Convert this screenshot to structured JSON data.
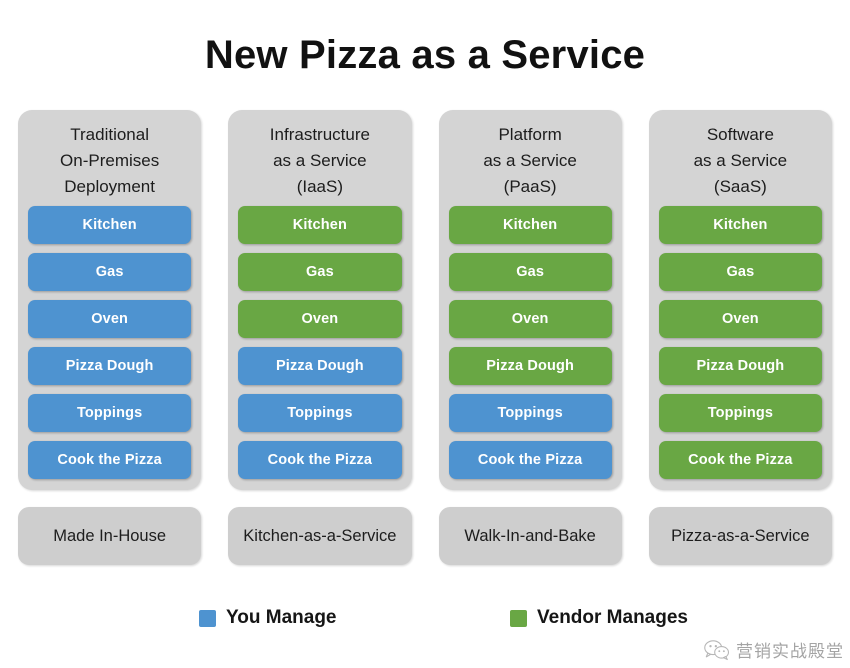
{
  "title": "New Pizza as a Service",
  "colors": {
    "you_manage": "#4e93d0",
    "vendor_manages": "#69a744",
    "panel_background": "#d4d4d4",
    "caption_background": "#cecece",
    "page_background": "#ffffff"
  },
  "columns": [
    {
      "id": "traditional",
      "header_lines": [
        "Traditional",
        "On-Premises",
        "Deployment"
      ],
      "caption": "Made In-House",
      "items": [
        {
          "label": "Kitchen",
          "owner": "you"
        },
        {
          "label": "Gas",
          "owner": "you"
        },
        {
          "label": "Oven",
          "owner": "you"
        },
        {
          "label": "Pizza Dough",
          "owner": "you"
        },
        {
          "label": "Toppings",
          "owner": "you"
        },
        {
          "label": "Cook the Pizza",
          "owner": "you"
        }
      ]
    },
    {
      "id": "iaas",
      "header_lines": [
        "Infrastructure",
        "as a Service",
        "(IaaS)"
      ],
      "caption": "Kitchen-as-a-Service",
      "items": [
        {
          "label": "Kitchen",
          "owner": "vendor"
        },
        {
          "label": "Gas",
          "owner": "vendor"
        },
        {
          "label": "Oven",
          "owner": "vendor"
        },
        {
          "label": "Pizza Dough",
          "owner": "you"
        },
        {
          "label": "Toppings",
          "owner": "you"
        },
        {
          "label": "Cook the Pizza",
          "owner": "you"
        }
      ]
    },
    {
      "id": "paas",
      "header_lines": [
        "Platform",
        "as a Service",
        "(PaaS)"
      ],
      "caption": "Walk-In-and-Bake",
      "items": [
        {
          "label": "Kitchen",
          "owner": "vendor"
        },
        {
          "label": "Gas",
          "owner": "vendor"
        },
        {
          "label": "Oven",
          "owner": "vendor"
        },
        {
          "label": "Pizza Dough",
          "owner": "vendor"
        },
        {
          "label": "Toppings",
          "owner": "you"
        },
        {
          "label": "Cook the Pizza",
          "owner": "you"
        }
      ]
    },
    {
      "id": "saas",
      "header_lines": [
        "Software",
        "as a Service",
        "(SaaS)"
      ],
      "caption": "Pizza-as-a-Service",
      "items": [
        {
          "label": "Kitchen",
          "owner": "vendor"
        },
        {
          "label": "Gas",
          "owner": "vendor"
        },
        {
          "label": "Oven",
          "owner": "vendor"
        },
        {
          "label": "Pizza Dough",
          "owner": "vendor"
        },
        {
          "label": "Toppings",
          "owner": "vendor"
        },
        {
          "label": "Cook the Pizza",
          "owner": "vendor"
        }
      ]
    }
  ],
  "legend": {
    "you_manage_label": "You Manage",
    "vendor_manages_label": "Vendor Manages"
  },
  "watermark": {
    "icon": "wechat-icon",
    "text": "营销实战殿堂"
  }
}
